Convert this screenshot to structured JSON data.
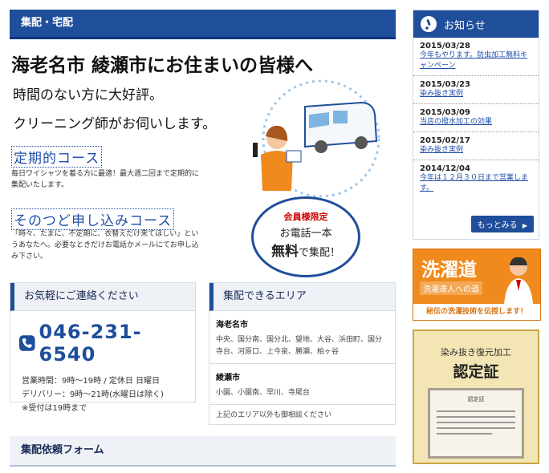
{
  "main": {
    "section_bar": "集配・宅配",
    "headline": "海老名市 綾瀬市にお住まいの皆様へ",
    "lead1": "時間のない方に大好評。",
    "lead2": "クリーニング師がお伺いします。",
    "course1_title": "定期的コース",
    "course1_desc": "毎日ワイシャツを着る方に最適！最大週二回まで定期的に集配いたします。",
    "course2_title": "そのつど申し込みコース",
    "course2_desc": "「時々、たまに、不定期に、衣替えだけ来てほしい」というあなたへ。必要なときだけお電話かメールにてお申し込み下さい。",
    "badge": {
      "line1": "会員様限定",
      "line2": "お電話一本",
      "line3a": "無料",
      "line3b": "で集配！"
    }
  },
  "contact": {
    "title": "お気軽にご連絡ください",
    "phone": "046-231-6540",
    "hours1": "営業時間：9時〜19時 / 定休日 日曜日",
    "hours2": "デリバリー：9時〜21時(水曜日は除く)",
    "hours3": "※受付は19時まで"
  },
  "area": {
    "title": "集配できるエリア",
    "city1": "海老名市",
    "city1_areas": "中央、国分南、国分北、望地、大谷、浜田町、国分寺台、河原口、上今泉、勝瀬、柏ヶ谷",
    "city2": "綾瀬市",
    "city2_areas": "小園、小園南、早川、寺尾台",
    "note": "上記のエリア以外も御相談ください"
  },
  "form_bar": "集配依頼フォーム",
  "news": {
    "title": "お知らせ",
    "items": [
      {
        "date": "2015/03/28",
        "text": "今年もやります。防虫加工無料キャンペーン"
      },
      {
        "date": "2015/03/23",
        "text": "染み抜き実例"
      },
      {
        "date": "2015/03/09",
        "text": "当店の撥水加工の効果"
      },
      {
        "date": "2015/02/17",
        "text": "染み抜き実例"
      },
      {
        "date": "2014/12/04",
        "text": "今年は１２月３０日まで営業します。"
      }
    ],
    "more": "もっとみる"
  },
  "banner1": {
    "title": "洗濯道",
    "sub": "洗濯達人への道",
    "caption": "秘伝の洗濯技術を伝授します！"
  },
  "banner2": {
    "line1": "染み抜き復元加工",
    "line2": "認定証",
    "cert_title": "認定証"
  },
  "colors": {
    "primary": "#1f4e9a",
    "accent_red": "#cc0000",
    "banner_orange": "#f08a1c"
  }
}
